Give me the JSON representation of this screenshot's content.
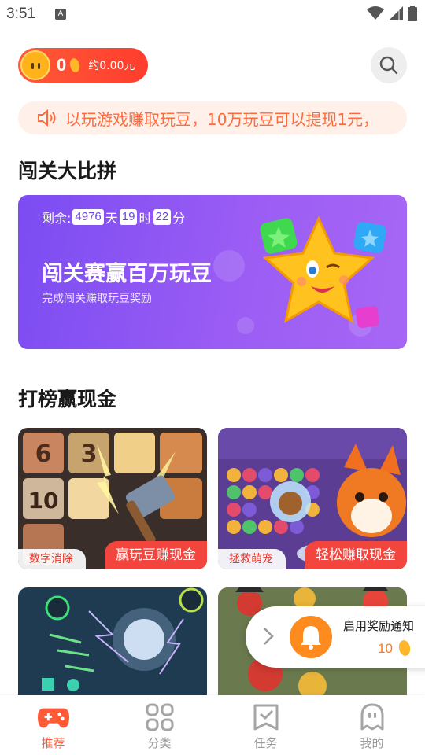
{
  "status_bar": {
    "time": "3:51",
    "notification_glyph": "A"
  },
  "header": {
    "coin_count": "0",
    "coin_approx": "约0.00元",
    "search_icon": "search-icon"
  },
  "marquee": {
    "text": "以玩游戏赚取玩豆，10万玩豆可以提现1元，"
  },
  "section_challenge": {
    "title": "闯关大比拼"
  },
  "challenge_banner": {
    "remaining_label": "剩余:",
    "days": "4976",
    "days_unit": "天",
    "hours": "19",
    "hours_unit": "时",
    "minutes": "22",
    "minutes_unit": "分",
    "title": "闯关赛赢百万玩豆",
    "subtitle": "完成闯关赚取玩豆奖励"
  },
  "section_ranking": {
    "title": "打榜赢现金"
  },
  "games": [
    {
      "tag": "数字消除",
      "action": "赢玩豆赚现金"
    },
    {
      "tag": "拯救萌宠",
      "action": "轻松赚取现金"
    }
  ],
  "notify_popup": {
    "text": "启用奖励通知",
    "count": "10"
  },
  "tabbar": {
    "items": [
      {
        "label": "推荐",
        "icon": "gamepad-icon"
      },
      {
        "label": "分类",
        "icon": "grid-icon"
      },
      {
        "label": "任务",
        "icon": "task-icon"
      },
      {
        "label": "我的",
        "icon": "ghost-icon"
      }
    ]
  },
  "colors": {
    "accent": "#ff5a36",
    "banner": "#8a55f3",
    "tag_red": "#f2453d",
    "tab_inactive": "#999999"
  }
}
